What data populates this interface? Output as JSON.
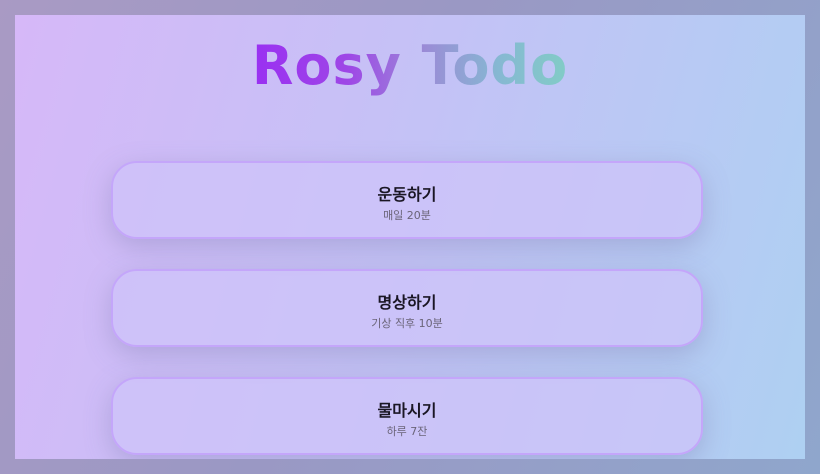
{
  "app": {
    "title": "Rosy Todo"
  },
  "todos": [
    {
      "title": "운동하기",
      "detail": "매일 20분"
    },
    {
      "title": "명상하기",
      "detail": "기상 직후 10분"
    },
    {
      "title": "물마시기",
      "detail": "하루 7잔"
    }
  ],
  "colors": {
    "title_gradient_start": "#9a30f2",
    "title_gradient_end": "#82ccc6",
    "card_border": "#c4a6fa",
    "background_left": "#d6b8f8",
    "background_right": "#aed0f2"
  }
}
